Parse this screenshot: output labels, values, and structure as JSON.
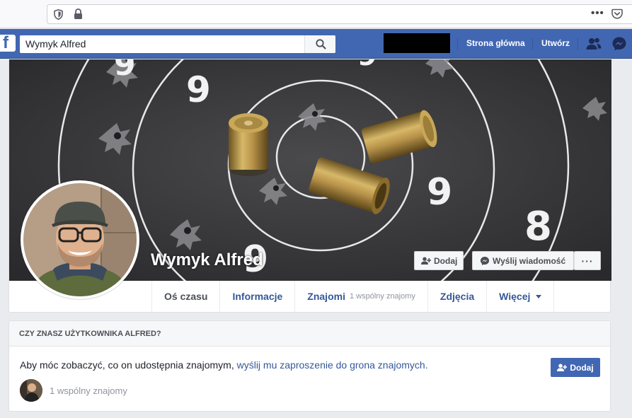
{
  "browser": {
    "menu_dots": "•••"
  },
  "topbar": {
    "search_query": "Wymyk Alfred",
    "logo_letter": "f",
    "nav": {
      "home": "Strona główna",
      "create": "Utwórz"
    }
  },
  "profile": {
    "name": "Wymyk Alfred",
    "cover_buttons": {
      "add_friend": "Dodaj",
      "send_message": "Wyślij wiadomość",
      "more": "···"
    },
    "cover_target_digits": [
      "9",
      "9",
      "9",
      "8",
      "9",
      "9"
    ]
  },
  "tabs": [
    {
      "label": "Oś czasu",
      "sub": ""
    },
    {
      "label": "Informacje",
      "sub": ""
    },
    {
      "label": "Znajomi",
      "sub": "1 wspólny znajomy"
    },
    {
      "label": "Zdjęcia",
      "sub": ""
    },
    {
      "label": "Więcej",
      "sub": ""
    }
  ],
  "know_card": {
    "header": "CZY ZNASZ UŻYTKOWNIKA ALFRED?",
    "text_plain": "Aby móc zobaczyć, co on udostępnia znajomym, ",
    "text_link": "wyślij mu zaproszenie do grona znajomych.",
    "add_button": "Dodaj",
    "mutual_friends": "1 wspólny znajomy"
  },
  "colors": {
    "fb_blue": "#4267b2",
    "link_blue": "#365899",
    "page_bg": "#e9ebee"
  }
}
